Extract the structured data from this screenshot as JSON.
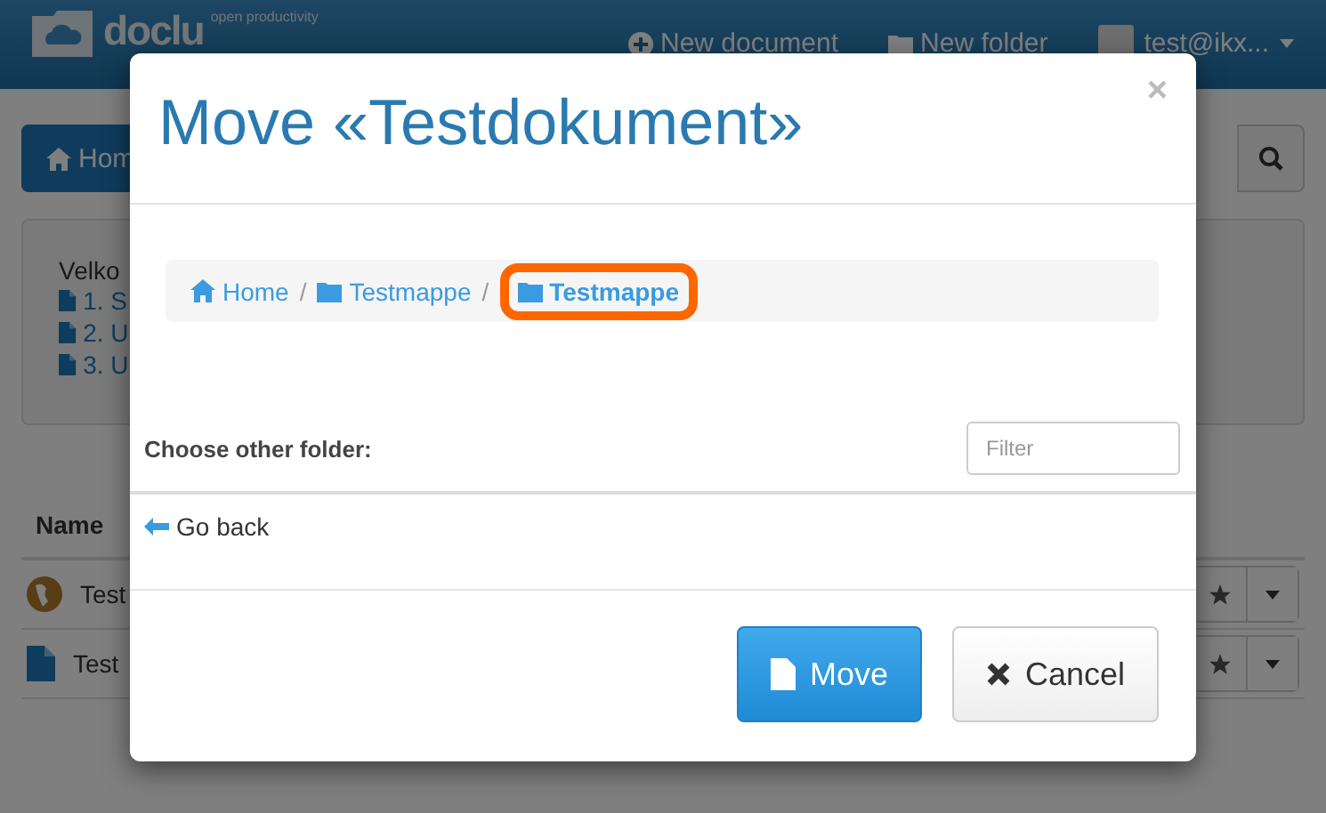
{
  "navbar": {
    "logo": "doclu",
    "tagline": "open productivity",
    "links": [
      {
        "kind": "new-document",
        "label": "New document"
      },
      {
        "kind": "new-folder",
        "label": "New folder"
      }
    ],
    "user": "test@ikx..."
  },
  "toolbar": {
    "home_button": "Hom"
  },
  "welcome": {
    "greeting": "Velko",
    "items": [
      "1. S",
      "2. U",
      "3. U"
    ]
  },
  "table": {
    "columns": [
      "Name"
    ],
    "rows": [
      {
        "kind": "globe",
        "name": "Test"
      },
      {
        "kind": "document",
        "name": "Test"
      }
    ]
  },
  "dialog": {
    "title": "Move «Testdokument»",
    "close": "×",
    "breadcrumb": [
      {
        "kind": "home",
        "label": "Home",
        "selected": false
      },
      {
        "kind": "folder",
        "label": "Testmappe",
        "selected": false
      },
      {
        "kind": "folder",
        "label": "Testmappe",
        "selected": true
      }
    ],
    "separator": "/",
    "choose_label": "Choose other folder:",
    "filter_placeholder": "Filter",
    "go_back": "Go back",
    "buttons": [
      {
        "kind": "primary",
        "label": "Move"
      },
      {
        "kind": "default",
        "label": "Cancel"
      }
    ]
  }
}
